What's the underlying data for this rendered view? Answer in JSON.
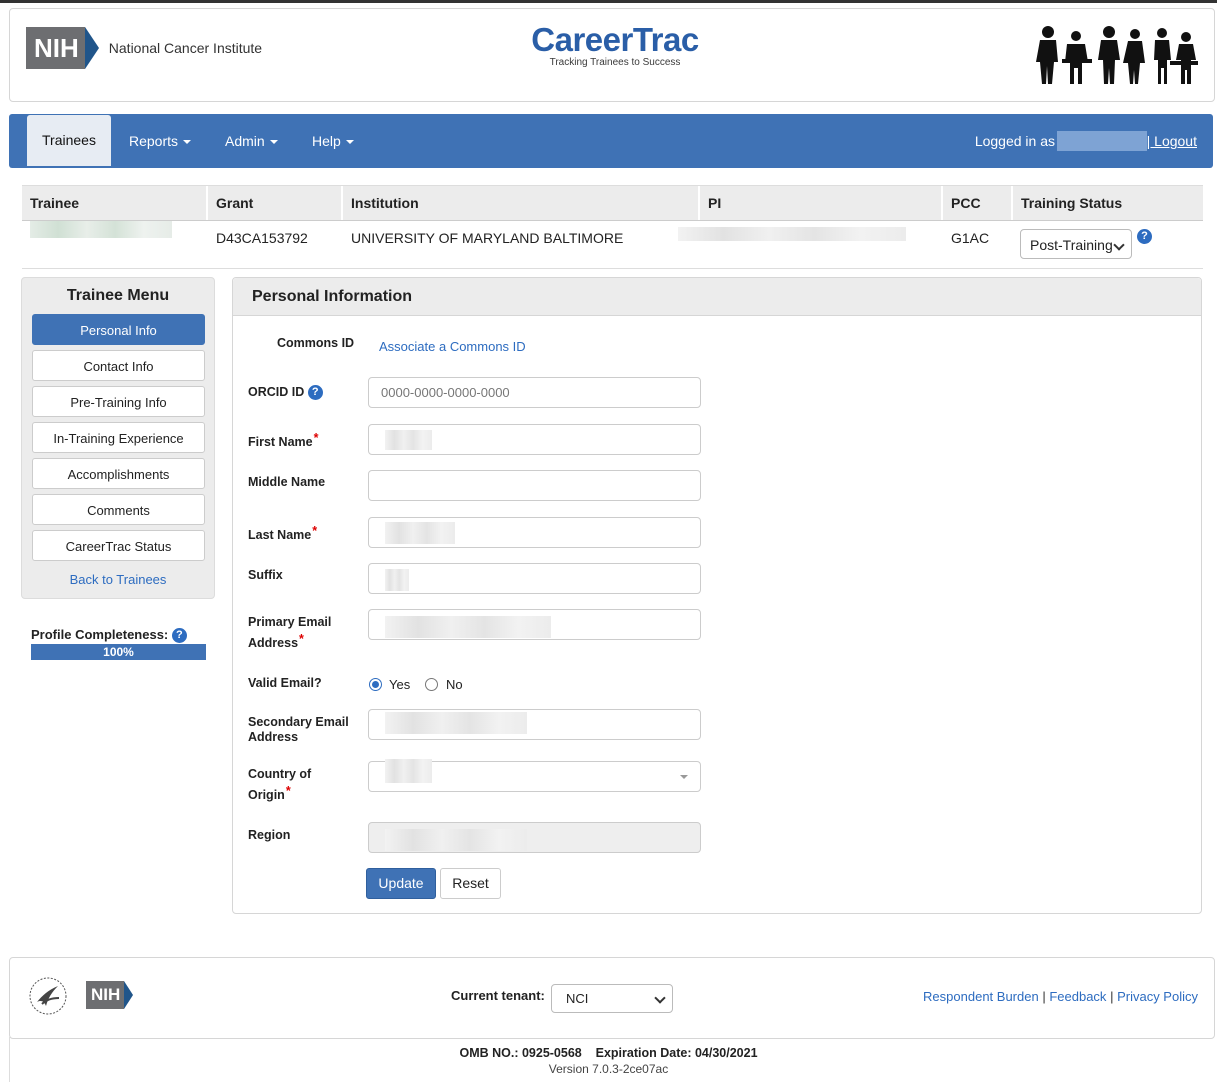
{
  "header": {
    "org_short": "NIH",
    "org_name": "National Cancer Institute",
    "app_title": "CareerTrac",
    "app_tagline": "Tracking Trainees to Success"
  },
  "nav": {
    "items": [
      {
        "label": "Trainees"
      },
      {
        "label": "Reports"
      },
      {
        "label": "Admin"
      },
      {
        "label": "Help"
      }
    ],
    "logged_in_label": "Logged in as",
    "logout_label": "| Logout"
  },
  "trainee_table": {
    "headers": [
      "Trainee",
      "Grant",
      "Institution",
      "PI",
      "PCC",
      "Training Status"
    ],
    "grant": "D43CA153792",
    "institution": "UNIVERSITY OF MARYLAND BALTIMORE",
    "pcc": "G1AC",
    "training_status": "Post-Training"
  },
  "menu": {
    "title": "Trainee Menu",
    "items": [
      {
        "label": "Personal Info"
      },
      {
        "label": "Contact Info"
      },
      {
        "label": "Pre-Training Info"
      },
      {
        "label": "In-Training Experience"
      },
      {
        "label": "Accomplishments"
      },
      {
        "label": "Comments"
      },
      {
        "label": "CareerTrac Status"
      }
    ],
    "back_label": "Back to Trainees",
    "profile_label": "Profile Completeness:",
    "profile_value": "100%",
    "profile_fraction": 1.0
  },
  "form": {
    "title": "Personal Information",
    "commons_id_label": "Commons ID",
    "commons_id_link": "Associate a Commons ID",
    "orcid_label": "ORCID ID",
    "orcid_placeholder": "0000-0000-0000-0000",
    "first_name_label": "First Name",
    "middle_name_label": "Middle Name",
    "last_name_label": "Last Name",
    "suffix_label": "Suffix",
    "primary_email_label_1": "Primary Email",
    "primary_email_label_2": "Address",
    "valid_email_label": "Valid Email?",
    "valid_yes": "Yes",
    "valid_no": "No",
    "secondary_email_label_1": "Secondary Email",
    "secondary_email_label_2": "Address",
    "country_label_1": "Country of",
    "country_label_2": "Origin",
    "region_label": "Region",
    "required_mark": "*",
    "update_label": "Update",
    "reset_label": "Reset"
  },
  "footer": {
    "org_short": "NIH",
    "tenant_label": "Current tenant:",
    "tenant_value": "NCI",
    "links": [
      "Respondent Burden",
      "Feedback",
      "Privacy Policy"
    ],
    "link_separator": "|",
    "omb": "OMB NO.: 0925-0568    Expiration Date: 04/30/2021",
    "version": "Version 7.0.3-2ce07ac"
  },
  "colors": {
    "primary": "#3f72b5",
    "link": "#2d6cc0",
    "required": "#dd0000"
  }
}
